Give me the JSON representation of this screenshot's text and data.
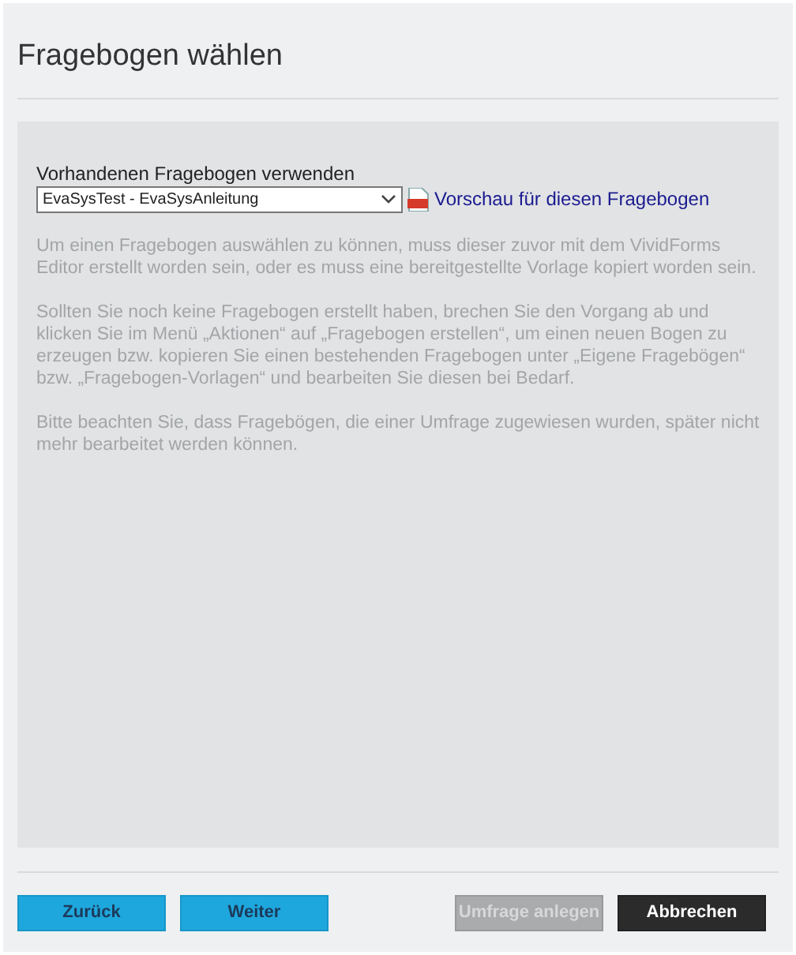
{
  "title": "Fragebogen wählen",
  "select": {
    "label": "Vorhandenen Fragebogen verwenden",
    "value": "EvaSysTest - EvaSysAnleitung"
  },
  "preview_link": "Vorschau für diesen Fragebogen",
  "paragraphs": [
    "Um einen Fragebogen auswählen zu können, muss dieser zuvor mit dem VividForms Editor erstellt worden sein, oder es muss eine bereitgestellte Vorlage kopiert worden sein.",
    "Sollten Sie noch keine Fragebogen erstellt haben, brechen Sie den Vorgang ab und klicken Sie im Menü „Aktionen“ auf „Fragebogen erstellen“, um einen neuen Bogen zu erzeugen bzw. kopieren Sie einen bestehenden Fragebogen unter „Eigene Fragebögen“ bzw. „Fragebogen-Vorlagen“ und bearbeiten Sie diesen bei Bedarf.",
    "Bitte beachten Sie, dass Fragebögen, die einer Umfrage zugewiesen wurden, später nicht mehr bearbeitet werden können."
  ],
  "buttons": [
    {
      "label": "Zurück",
      "kind": "primary",
      "disabled": false
    },
    {
      "label": "Weiter",
      "kind": "primary",
      "disabled": false
    },
    {
      "label": "Umfrage anlegen",
      "kind": "action",
      "disabled": true
    },
    {
      "label": "Abbrechen",
      "kind": "dark",
      "disabled": false
    }
  ]
}
